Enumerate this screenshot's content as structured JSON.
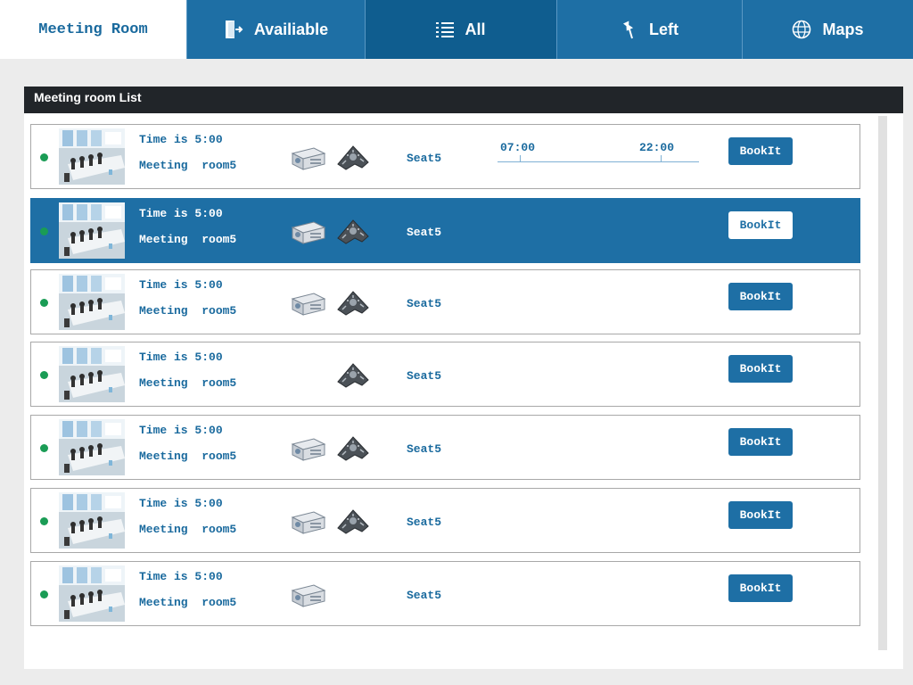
{
  "app": {
    "title": "Meeting Room"
  },
  "nav": {
    "tabs": [
      {
        "label": "Availiable",
        "icon": "door-exit-icon"
      },
      {
        "label": "All",
        "icon": "list-icon"
      },
      {
        "label": "Left",
        "icon": "pin-icon"
      },
      {
        "label": "Maps",
        "icon": "globe-icon"
      }
    ],
    "active_tab": "All"
  },
  "panel": {
    "title": "Meeting room List"
  },
  "rooms": [
    {
      "time": "Time is 5:00",
      "name": "Meeting  room5",
      "seat": "Seat5",
      "book_label": "BookIt",
      "status": "available",
      "equipment": [
        "projector-icon",
        "conference-phone-icon"
      ],
      "timeline": {
        "start": "07:00",
        "end": "22:00"
      }
    },
    {
      "time": "Time is 5:00",
      "name": "Meeting  room5",
      "seat": "Seat5",
      "book_label": "BookIt",
      "status": "available",
      "equipment": [
        "projector-icon",
        "conference-phone-icon"
      ],
      "selected": true
    },
    {
      "time": "Time is 5:00",
      "name": "Meeting  room5",
      "seat": "Seat5",
      "book_label": "BookIt",
      "status": "available",
      "equipment": [
        "projector-icon",
        "conference-phone-icon"
      ]
    },
    {
      "time": "Time is 5:00",
      "name": "Meeting  room5",
      "seat": "Seat5",
      "book_label": "BookIt",
      "status": "available",
      "equipment": [
        "conference-phone-icon"
      ]
    },
    {
      "time": "Time is 5:00",
      "name": "Meeting  room5",
      "seat": "Seat5",
      "book_label": "BookIt",
      "status": "available",
      "equipment": [
        "projector-icon",
        "conference-phone-icon"
      ]
    },
    {
      "time": "Time is 5:00",
      "name": "Meeting  room5",
      "seat": "Seat5",
      "book_label": "BookIt",
      "status": "available",
      "equipment": [
        "projector-icon",
        "conference-phone-icon"
      ]
    },
    {
      "time": "Time is 5:00",
      "name": "Meeting  room5",
      "seat": "Seat5",
      "book_label": "BookIt",
      "status": "available",
      "equipment": [
        "projector-icon"
      ]
    }
  ],
  "colors": {
    "accent": "#1e6fa5",
    "header": "#212529",
    "status_available": "#1a9c55"
  }
}
